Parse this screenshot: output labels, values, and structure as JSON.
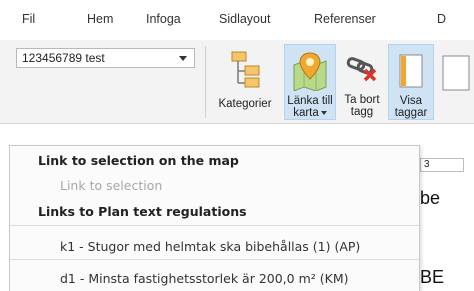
{
  "tabs": [
    "Fil",
    "Hem",
    "Infoga",
    "Sidlayout",
    "Referenser",
    "D"
  ],
  "combo": {
    "value": "123456789 test"
  },
  "buttons": {
    "kategorier": "Kategorier",
    "lanka_line1": "Länka till",
    "lanka_line2": "karta",
    "tabort_line1": "Ta bort",
    "tabort_line2": "tagg",
    "visa_line1": "Visa",
    "visa_line2": "taggar"
  },
  "document": {
    "ruler_value": "3",
    "text1": "be",
    "text2": "BE"
  },
  "menu": {
    "header1": "Link to selection on the map",
    "link_to_selection": "Link to selection",
    "header2": "Links to Plan text regulations",
    "items": [
      "k1 - Stugor med helmtak ska bibehållas (1) (AP)",
      "d1 - Minsta fastighetsstorlek är 200,0 m² (KM)"
    ]
  },
  "colors": {
    "active_button": "#cfe3f5",
    "ribbon": "#f3f3f3"
  }
}
